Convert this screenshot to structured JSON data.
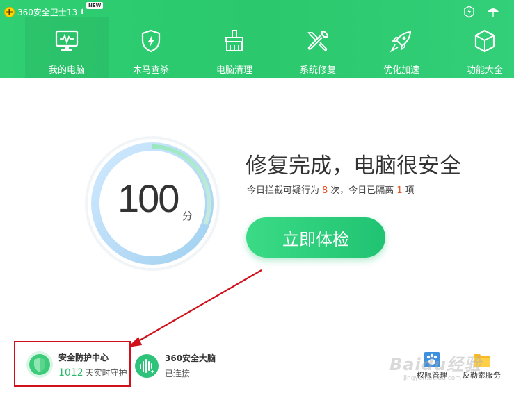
{
  "app": {
    "title": "360安全卫士13",
    "badge": "NEW"
  },
  "nav": [
    {
      "label": "我的电脑",
      "icon": "monitor-icon",
      "active": true
    },
    {
      "label": "木马查杀",
      "icon": "shield-bolt-icon"
    },
    {
      "label": "电脑清理",
      "icon": "broom-icon"
    },
    {
      "label": "系统修复",
      "icon": "wrench-icon"
    },
    {
      "label": "优化加速",
      "icon": "rocket-icon"
    },
    {
      "label": "功能大全",
      "icon": "cube-icon"
    }
  ],
  "score": {
    "value": 100,
    "unit": "分"
  },
  "status": {
    "title": "修复完成，电脑很安全",
    "sub_pre": "今日拦截可疑行为",
    "blocked_count": "8",
    "sub_mid": "次，今日已隔离",
    "isolated_count": "1",
    "sub_post": "项"
  },
  "check_button": "立即体检",
  "bottom": {
    "protect": {
      "title": "安全防护中心",
      "days": "1012",
      "days_suffix": "天实时守护"
    },
    "brain": {
      "title": "360安全大脑",
      "status": "已连接"
    },
    "permission": "权限管理",
    "ransom": "反勒索服务"
  },
  "watermark": {
    "brand": "Baidu经验",
    "sub": "jingyan.baidu.com"
  },
  "colors": {
    "accent": "#2bc86d",
    "annotation": "#d0101a",
    "highlight_number": "#e0521f"
  }
}
